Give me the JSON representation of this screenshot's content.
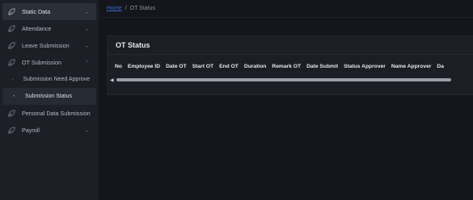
{
  "sidebar": {
    "items": [
      {
        "label": "Static Data",
        "chevron": "⌄",
        "icon": "leaf-icon"
      },
      {
        "label": "Attendance",
        "chevron": "⌄",
        "icon": "leaf-icon"
      },
      {
        "label": "Leave Submission",
        "chevron": "⌄",
        "icon": "leaf-icon"
      },
      {
        "label": "OT Submission",
        "chevron": "⌃",
        "icon": "leaf-icon"
      }
    ],
    "subitems": [
      {
        "label": "Submission Need Approve",
        "bullet": "-"
      },
      {
        "label": "Submission Status",
        "bullet": "•"
      }
    ],
    "items2": [
      {
        "label": "Personal Data Submission",
        "icon": "leaf-icon"
      },
      {
        "label": "Payroll",
        "chevron": "⌄",
        "icon": "leaf-icon"
      }
    ]
  },
  "breadcrumb": {
    "home": "Home",
    "separator": "/",
    "current": "OT Status"
  },
  "card": {
    "title": "OT Status"
  },
  "table": {
    "columns": [
      "No",
      "Employee ID",
      "Date OT",
      "Start OT",
      "End OT",
      "Duration",
      "Remark OT",
      "Date Submit",
      "Status Approver",
      "Name Approver",
      "Da"
    ]
  },
  "scrollbar": {
    "left_arrow": "◀"
  }
}
